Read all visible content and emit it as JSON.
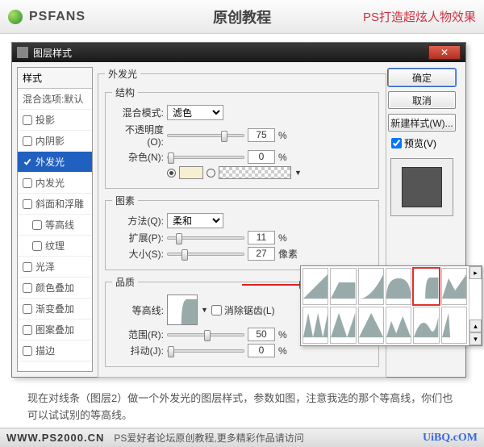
{
  "topbar": {
    "brand": "PSFANS",
    "center": "原创教程",
    "right": "PS打造超炫人物效果"
  },
  "dialog": {
    "title": "图层样式",
    "close_x": "✕",
    "styles_header": "样式",
    "styles_sub": "混合选项:默认",
    "items": [
      {
        "label": "投影",
        "checked": false
      },
      {
        "label": "内阴影",
        "checked": false
      },
      {
        "label": "外发光",
        "checked": true,
        "selected": true
      },
      {
        "label": "内发光",
        "checked": false
      },
      {
        "label": "斜面和浮雕",
        "checked": false
      },
      {
        "label": "等高线",
        "checked": false,
        "indent": true
      },
      {
        "label": "纹理",
        "checked": false,
        "indent": true
      },
      {
        "label": "光泽",
        "checked": false
      },
      {
        "label": "颜色叠加",
        "checked": false
      },
      {
        "label": "渐变叠加",
        "checked": false
      },
      {
        "label": "图案叠加",
        "checked": false
      },
      {
        "label": "描边",
        "checked": false
      }
    ],
    "effect_legend": "外发光",
    "group_structure": "结构",
    "blend_mode_label": "混合模式:",
    "blend_mode_value": "滤色",
    "opacity_label": "不透明度(O):",
    "opacity_value": "75",
    "percent": "%",
    "noise_label": "杂色(N):",
    "noise_value": "0",
    "group_image": "图素",
    "technique_label": "方法(Q):",
    "technique_value": "柔和",
    "spread_label": "扩展(P):",
    "spread_value": "11",
    "size_label": "大小(S):",
    "size_value": "27",
    "px": "像素",
    "group_quality": "品质",
    "contour_label": "等高线:",
    "antialias_label": "消除锯齿(L)",
    "range_label": "范围(R):",
    "range_value": "50",
    "jitter_label": "抖动(J):",
    "jitter_value": "0",
    "buttons": {
      "ok": "确定",
      "cancel": "取消",
      "new_style": "新建样式(W)...",
      "preview": "预览(V)"
    }
  },
  "caption": "现在对线条（图层2）做一个外发光的图层样式，参数如图，注意我选的那个等高线，你们也可以试试别的等高线。",
  "footer": {
    "url": "WWW.PS2000.CN",
    "text": "PS爱好者论坛原创教程,更多精彩作品请访问",
    "watermark": "UiBQ.cOM"
  }
}
